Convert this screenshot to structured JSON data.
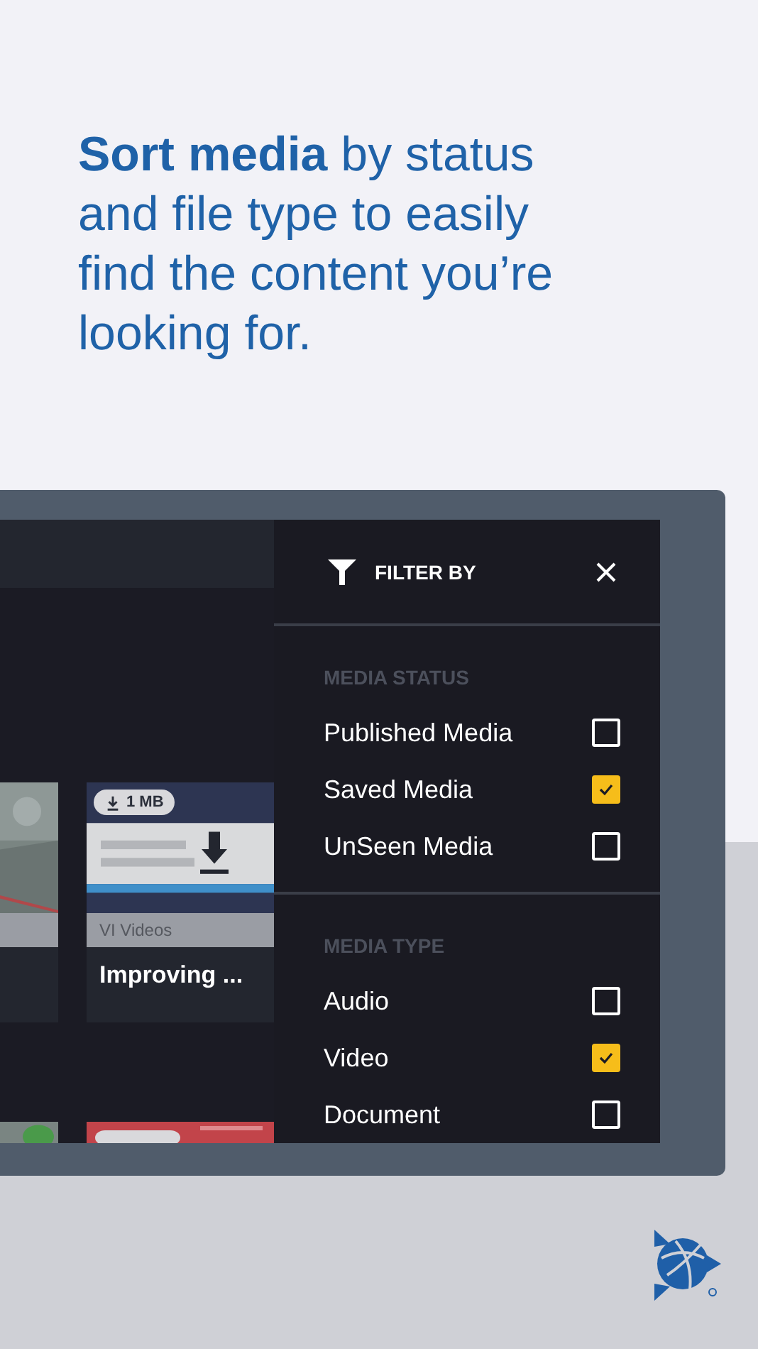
{
  "headline": "**Sort media** by status and file type to easily find the content you’re looking for.",
  "media_cards": [
    {
      "kind": "picture"
    },
    {
      "kind": "video",
      "size": "1 MB",
      "category": "VI Videos",
      "title": "Improving ..."
    }
  ],
  "filter": {
    "title": "FILTER BY",
    "sections": [
      {
        "heading": "MEDIA STATUS",
        "options": [
          {
            "label": "Published Media",
            "checked": false
          },
          {
            "label": "Saved Media",
            "checked": true
          },
          {
            "label": "UnSeen Media",
            "checked": false
          }
        ]
      },
      {
        "heading": "MEDIA TYPE",
        "options": [
          {
            "label": "Audio",
            "checked": false
          },
          {
            "label": "Video",
            "checked": true
          },
          {
            "label": "Document",
            "checked": false
          }
        ]
      }
    ]
  }
}
